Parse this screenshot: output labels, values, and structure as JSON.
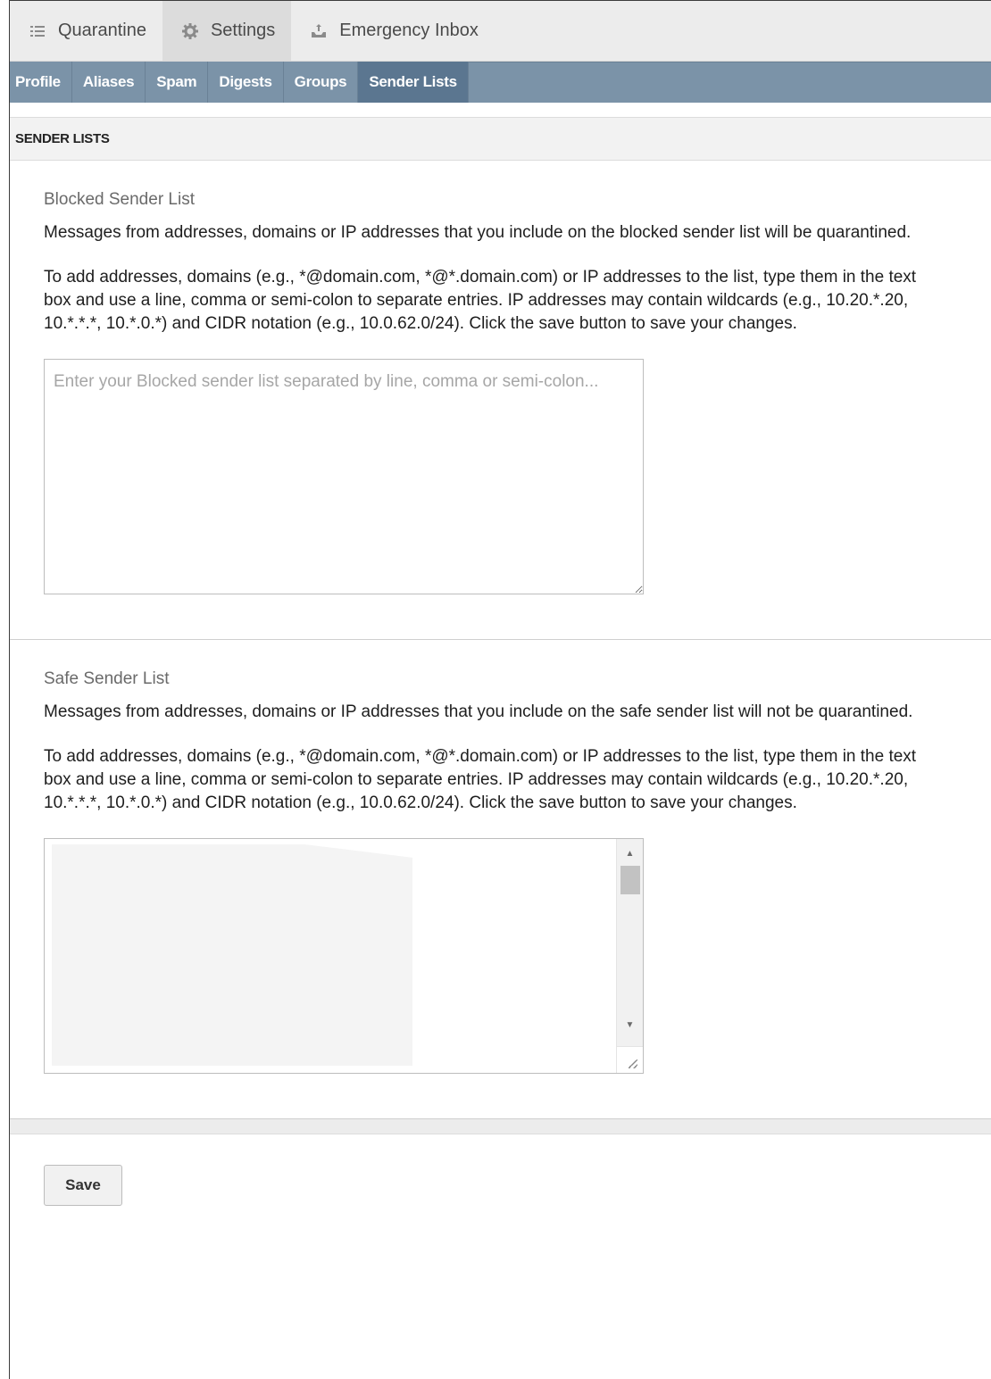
{
  "top_tabs": [
    {
      "label": "Quarantine",
      "icon": "list-icon"
    },
    {
      "label": "Settings",
      "icon": "gear-icon",
      "active": true
    },
    {
      "label": "Emergency Inbox",
      "icon": "inbox-icon"
    }
  ],
  "sub_tabs": [
    {
      "label": "Profile"
    },
    {
      "label": "Aliases"
    },
    {
      "label": "Spam"
    },
    {
      "label": "Digests"
    },
    {
      "label": "Groups"
    },
    {
      "label": "Sender Lists",
      "active": true
    }
  ],
  "section_header": "SENDER LISTS",
  "blocked": {
    "title": "Blocked Sender List",
    "desc1": "Messages from addresses, domains or IP addresses that you include on the blocked sender list will be quarantined.",
    "desc2": "To add addresses, domains (e.g., *@domain.com, *@*.domain.com) or IP addresses to the list, type them in the text box and use a line, comma or semi-colon to separate entries. IP addresses may contain wildcards (e.g., 10.20.*.20, 10.*.*.*, 10.*.0.*) and CIDR notation (e.g., 10.0.62.0/24). Click the save button to save your changes.",
    "placeholder": "Enter your Blocked sender list separated by line, comma or semi-colon..."
  },
  "safe": {
    "title": "Safe Sender List",
    "desc1": "Messages from addresses, domains or IP addresses that you include on the safe sender list will not be quarantined.",
    "desc2": "To add addresses, domains (e.g., *@domain.com, *@*.domain.com) or IP addresses to the list, type them in the text box and use a line, comma or semi-colon to separate entries. IP addresses may contain wildcards (e.g., 10.20.*.20, 10.*.*.*, 10.*.0.*) and CIDR notation (e.g., 10.0.62.0/24). Click the save button to save your changes."
  },
  "save_label": "Save",
  "colors": {
    "subnav_bg": "#7b93a8",
    "subnav_active": "#5b7690",
    "topbar_bg": "#ececec"
  }
}
